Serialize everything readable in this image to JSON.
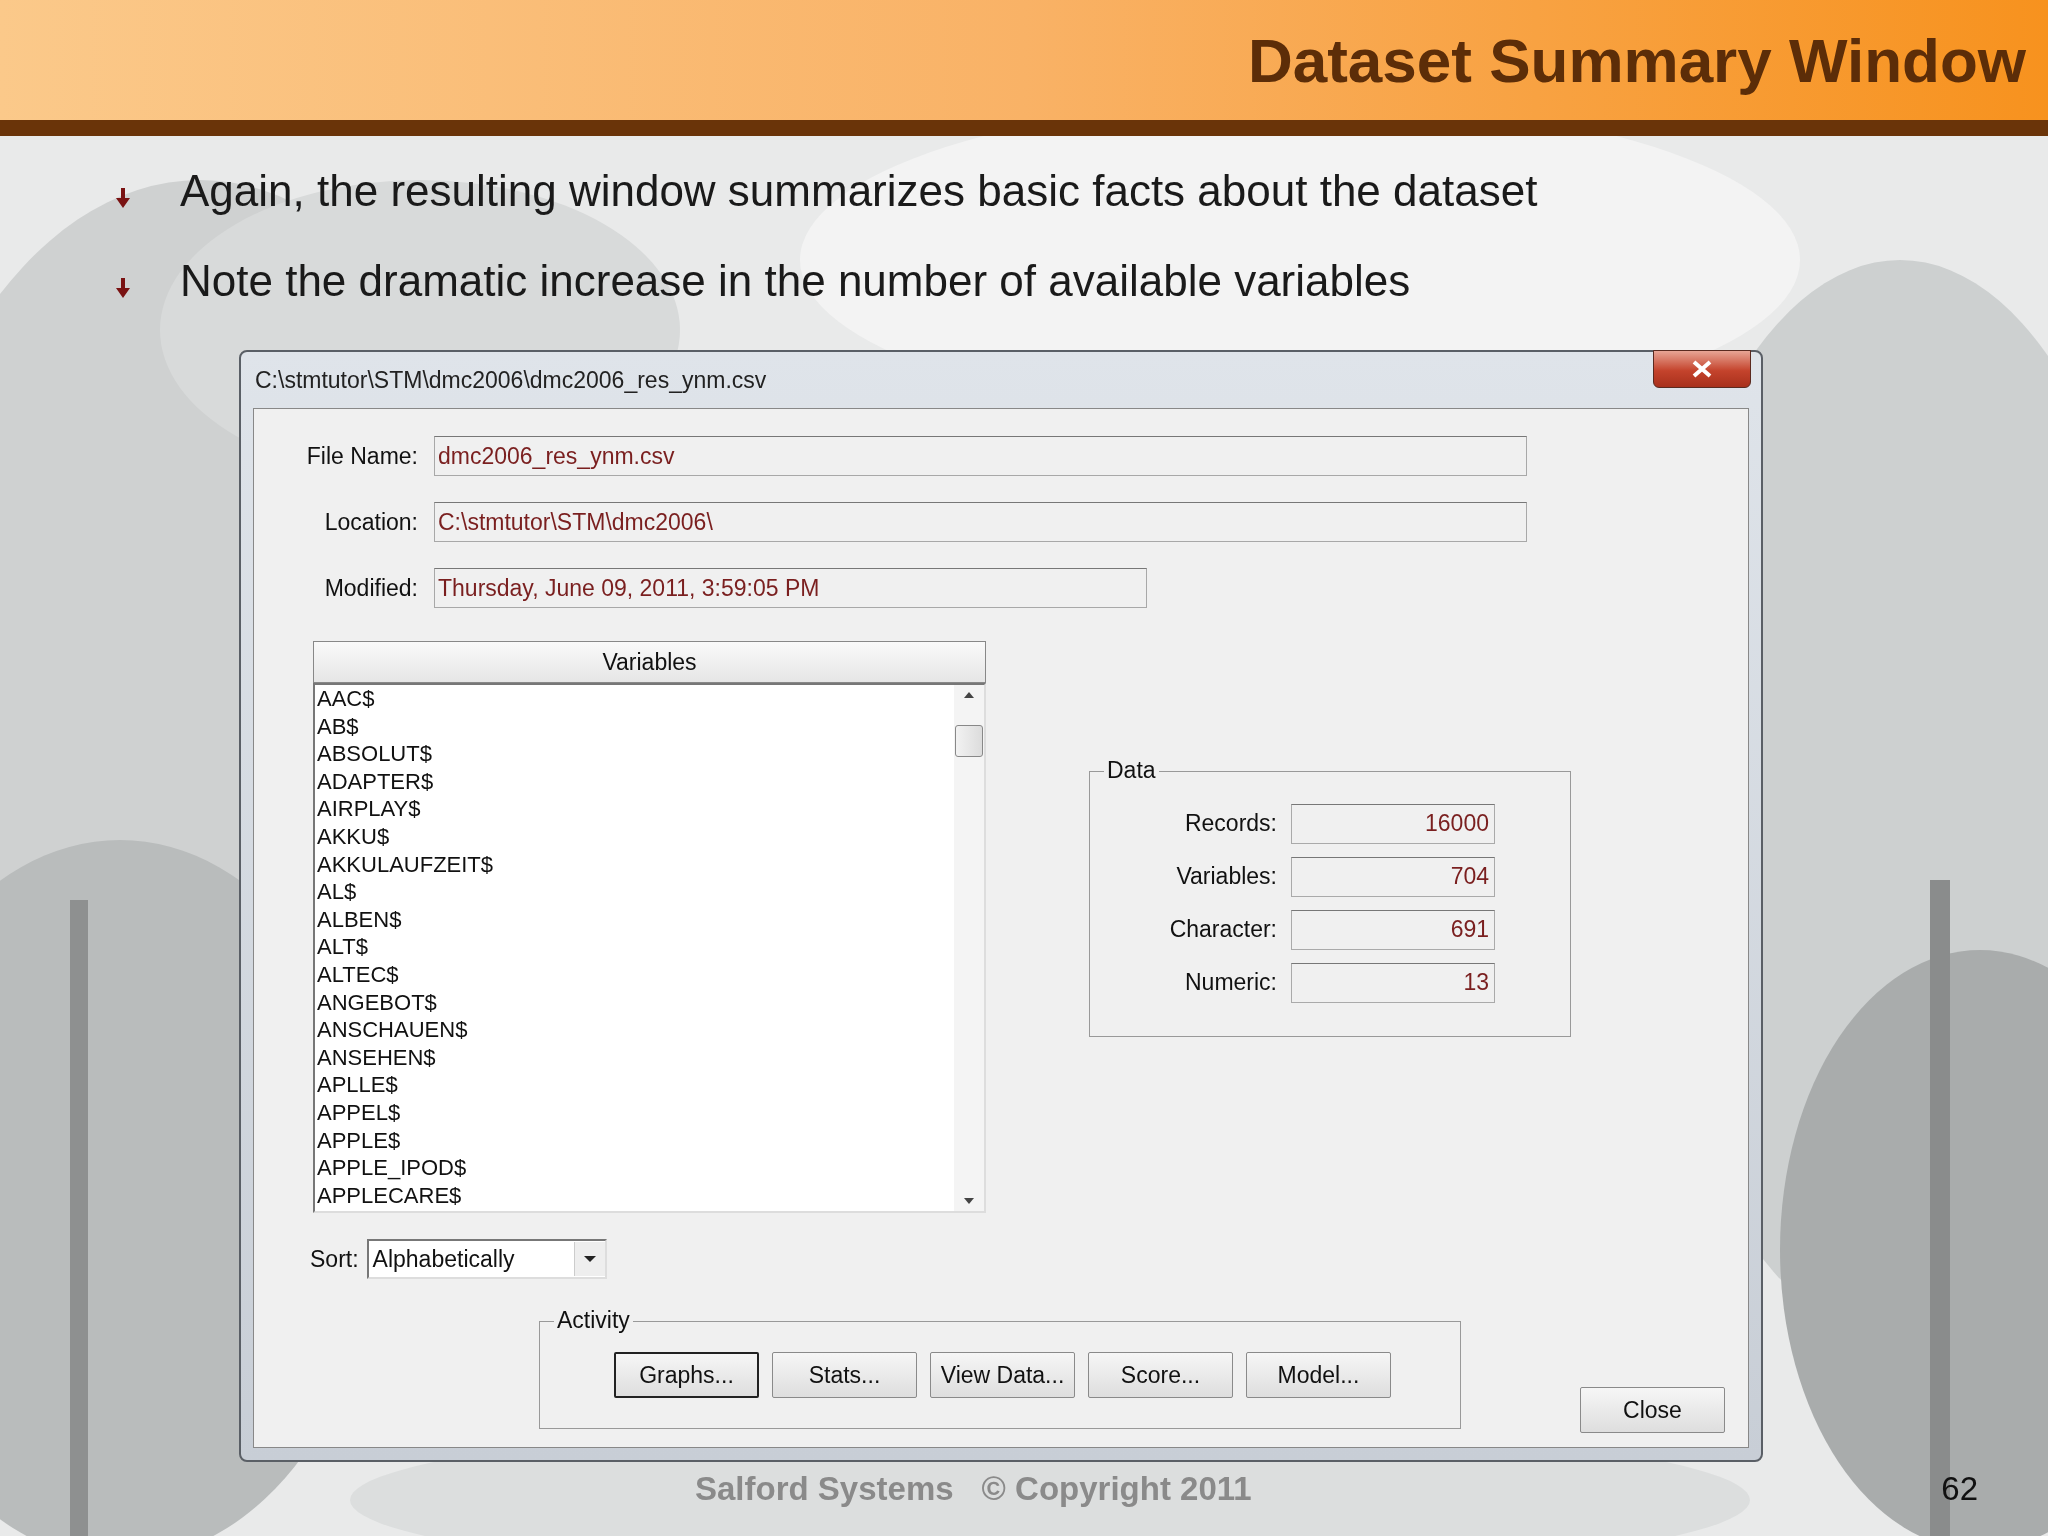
{
  "slide": {
    "title": "Dataset Summary Window",
    "bullets": [
      "Again, the resulting window summarizes basic facts about the dataset",
      "Note the dramatic increase in the number of available variables"
    ],
    "footer": [
      "Salford Systems",
      "© Copyright 2011"
    ],
    "page_number": "62"
  },
  "window": {
    "title": "C:\\stmtutor\\STM\\dmc2006\\dmc2006_res_ynm.csv",
    "fields": [
      {
        "label": "File Name:",
        "value": "dmc2006_res_ynm.csv",
        "wide": true
      },
      {
        "label": "Location:",
        "value": "C:\\stmtutor\\STM\\dmc2006\\",
        "wide": true
      },
      {
        "label": "Modified:",
        "value": "Thursday, June 09, 2011, 3:59:05 PM",
        "wide": false
      }
    ],
    "variables": {
      "header": "Variables",
      "items": [
        "AAC$",
        "AB$",
        "ABSOLUT$",
        "ADAPTER$",
        "AIRPLAY$",
        "AKKU$",
        "AKKULAUFZEIT$",
        "AL$",
        "ALBEN$",
        "ALT$",
        "ALTEC$",
        "ANGEBOT$",
        "ANSCHAUEN$",
        "ANSEHEN$",
        "APLLE$",
        "APPEL$",
        "APPLE$",
        "APPLE_IPOD$",
        "APPLECARE$"
      ]
    },
    "sort": {
      "label": "Sort:",
      "value": "Alphabetically"
    },
    "data": {
      "legend": "Data",
      "rows": [
        {
          "label": "Records:",
          "value": "16000"
        },
        {
          "label": "Variables:",
          "value": "704"
        },
        {
          "label": "Character:",
          "value": "691"
        },
        {
          "label": "Numeric:",
          "value": "13"
        }
      ]
    },
    "activity": {
      "legend": "Activity",
      "buttons": [
        {
          "label": "Graphs...",
          "default": true
        },
        {
          "label": "Stats...",
          "default": false
        },
        {
          "label": "View Data...",
          "default": false
        },
        {
          "label": "Score...",
          "default": false
        },
        {
          "label": "Model...",
          "default": false
        }
      ]
    },
    "close_button": "Close"
  }
}
